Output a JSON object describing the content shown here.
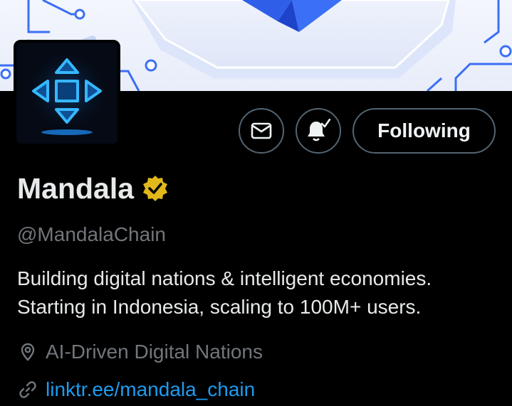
{
  "profile": {
    "display_name": "Mandala",
    "handle": "@MandalaChain",
    "bio_line_1": "Building digital nations & intelligent economies.",
    "bio_line_2": "Starting in Indonesia, scaling to 100M+ users.",
    "location": "AI-Driven Digital Nations",
    "website": "linktr.ee/mandala_chain",
    "verified": true
  },
  "actions": {
    "follow_label": "Following",
    "message_icon": "envelope-icon",
    "notify_icon": "bell-check-icon"
  },
  "icons": {
    "location": "location-pin-icon",
    "link": "link-chain-icon",
    "verified": "verified-badge-icon"
  },
  "colors": {
    "background": "#000000",
    "text_primary": "#e7e9ea",
    "text_secondary": "#71767b",
    "link": "#1d9bf0",
    "button_border": "#536471",
    "verified_gold": "#e2b719",
    "avatar_glow": "#1ea7ff"
  }
}
